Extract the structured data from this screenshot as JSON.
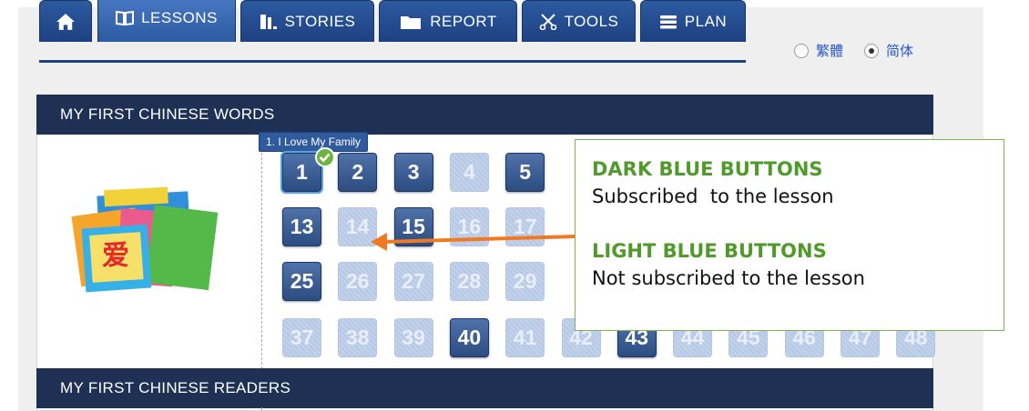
{
  "tabs": [
    {
      "label": "",
      "icon": "home-icon"
    },
    {
      "label": "LESSONS",
      "icon": "book-icon"
    },
    {
      "label": "STORIES",
      "icon": "stories-book-icon"
    },
    {
      "label": "REPORT",
      "icon": "folder-icon"
    },
    {
      "label": "TOOLS",
      "icon": "scissors-icon"
    },
    {
      "label": "PLAN",
      "icon": "list-icon"
    }
  ],
  "language": {
    "traditional": "繁體",
    "simplified": "简体",
    "selected": "simplified"
  },
  "sections": {
    "first_words": "MY FIRST CHINESE WORDS",
    "first_readers": "MY FIRST CHINESE READERS"
  },
  "tooltip": "1. I Love My Family",
  "lessons": {
    "row1": [
      {
        "n": "1",
        "state": "sub"
      },
      {
        "n": "2",
        "state": "sub"
      },
      {
        "n": "3",
        "state": "sub"
      },
      {
        "n": "4",
        "state": "unsub"
      },
      {
        "n": "5",
        "state": "sub"
      }
    ],
    "row2": [
      {
        "n": "13",
        "state": "sub"
      },
      {
        "n": "14",
        "state": "unsub"
      },
      {
        "n": "15",
        "state": "sub"
      },
      {
        "n": "16",
        "state": "unsub"
      },
      {
        "n": "17",
        "state": "unsub"
      }
    ],
    "row3": [
      {
        "n": "25",
        "state": "sub"
      },
      {
        "n": "26",
        "state": "unsub"
      },
      {
        "n": "27",
        "state": "unsub"
      },
      {
        "n": "28",
        "state": "unsub"
      },
      {
        "n": "29",
        "state": "unsub"
      }
    ],
    "row4": [
      {
        "n": "37",
        "state": "unsub"
      },
      {
        "n": "38",
        "state": "unsub"
      },
      {
        "n": "39",
        "state": "unsub"
      },
      {
        "n": "40",
        "state": "sub"
      },
      {
        "n": "41",
        "state": "unsub"
      },
      {
        "n": "42",
        "state": "unsub"
      },
      {
        "n": "43",
        "state": "sub"
      },
      {
        "n": "44",
        "state": "unsub"
      },
      {
        "n": "45",
        "state": "unsub"
      },
      {
        "n": "46",
        "state": "unsub"
      },
      {
        "n": "47",
        "state": "unsub"
      },
      {
        "n": "48",
        "state": "unsub"
      }
    ]
  },
  "callout": {
    "dark_title": "DARK BLUE BUTTONS",
    "dark_text": "Subscribed  to the lesson",
    "light_title": "LIGHT BLUE BUTTONS",
    "light_text": "Not subscribed to the lesson"
  },
  "colors": {
    "subscribed": "#2c4d82",
    "unsubscribed": "#c4d3ec",
    "header": "#1e3154",
    "callout_green": "#4f9a2a",
    "arrow": "#f07a22"
  }
}
